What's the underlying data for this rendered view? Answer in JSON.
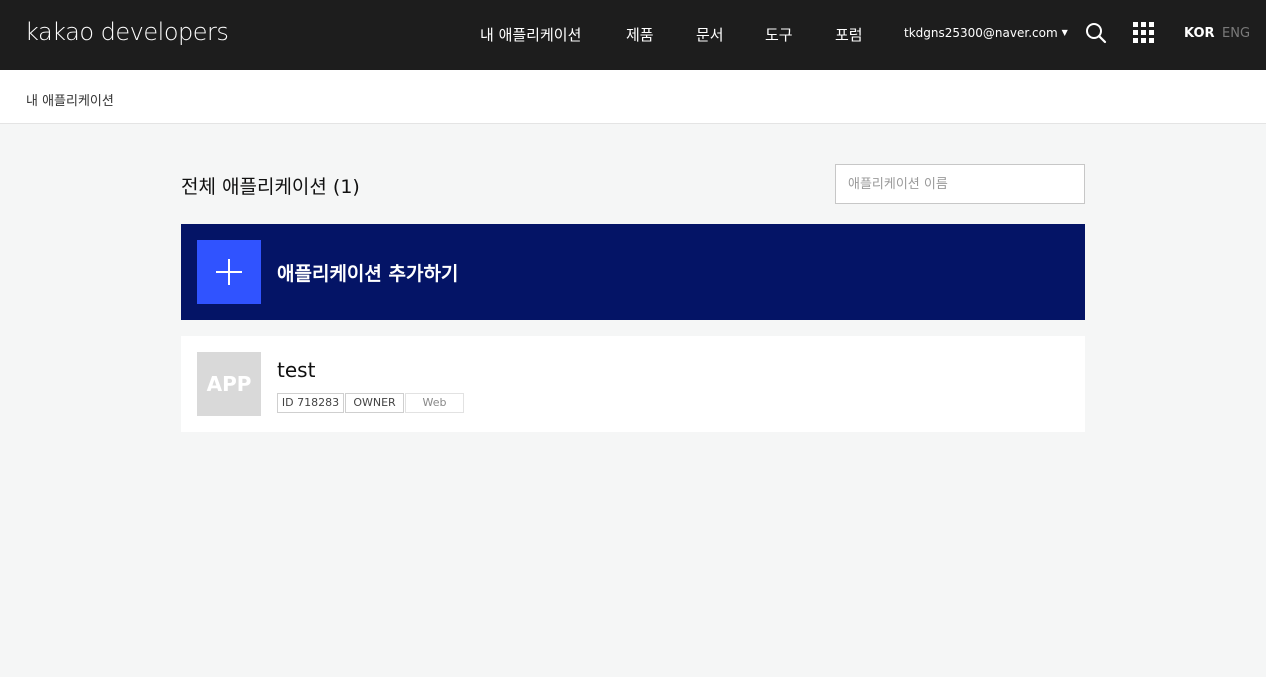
{
  "header": {
    "logo": "kakao developers",
    "nav": [
      {
        "label": "내 애플리케이션"
      },
      {
        "label": "제품"
      },
      {
        "label": "문서"
      },
      {
        "label": "도구"
      },
      {
        "label": "포럼"
      }
    ],
    "account": "tkdgns25300@naver.com",
    "icons": {
      "search": "search-icon",
      "apps": "apps-grid-icon",
      "caret": "caret-down-icon"
    },
    "languages": {
      "active": "KOR",
      "inactive": "ENG"
    }
  },
  "breadcrumb": "내 애플리케이션",
  "main": {
    "title": "전체 애플리케이션 (1)",
    "search": {
      "placeholder": "애플리케이션 이름",
      "value": ""
    },
    "add_app": {
      "label": "애플리케이션 추가하기",
      "icon": "plus-icon"
    },
    "apps": [
      {
        "thumbnail": "APP",
        "name": "test",
        "id_tag": "ID 718283",
        "role_tag": "OWNER",
        "platform_tag": "Web"
      }
    ]
  },
  "colors": {
    "topbar": "#1d1d1d",
    "add_app_bg": "#041466",
    "add_icon_bg": "#3053ff",
    "page_bg": "#f5f6f6"
  }
}
